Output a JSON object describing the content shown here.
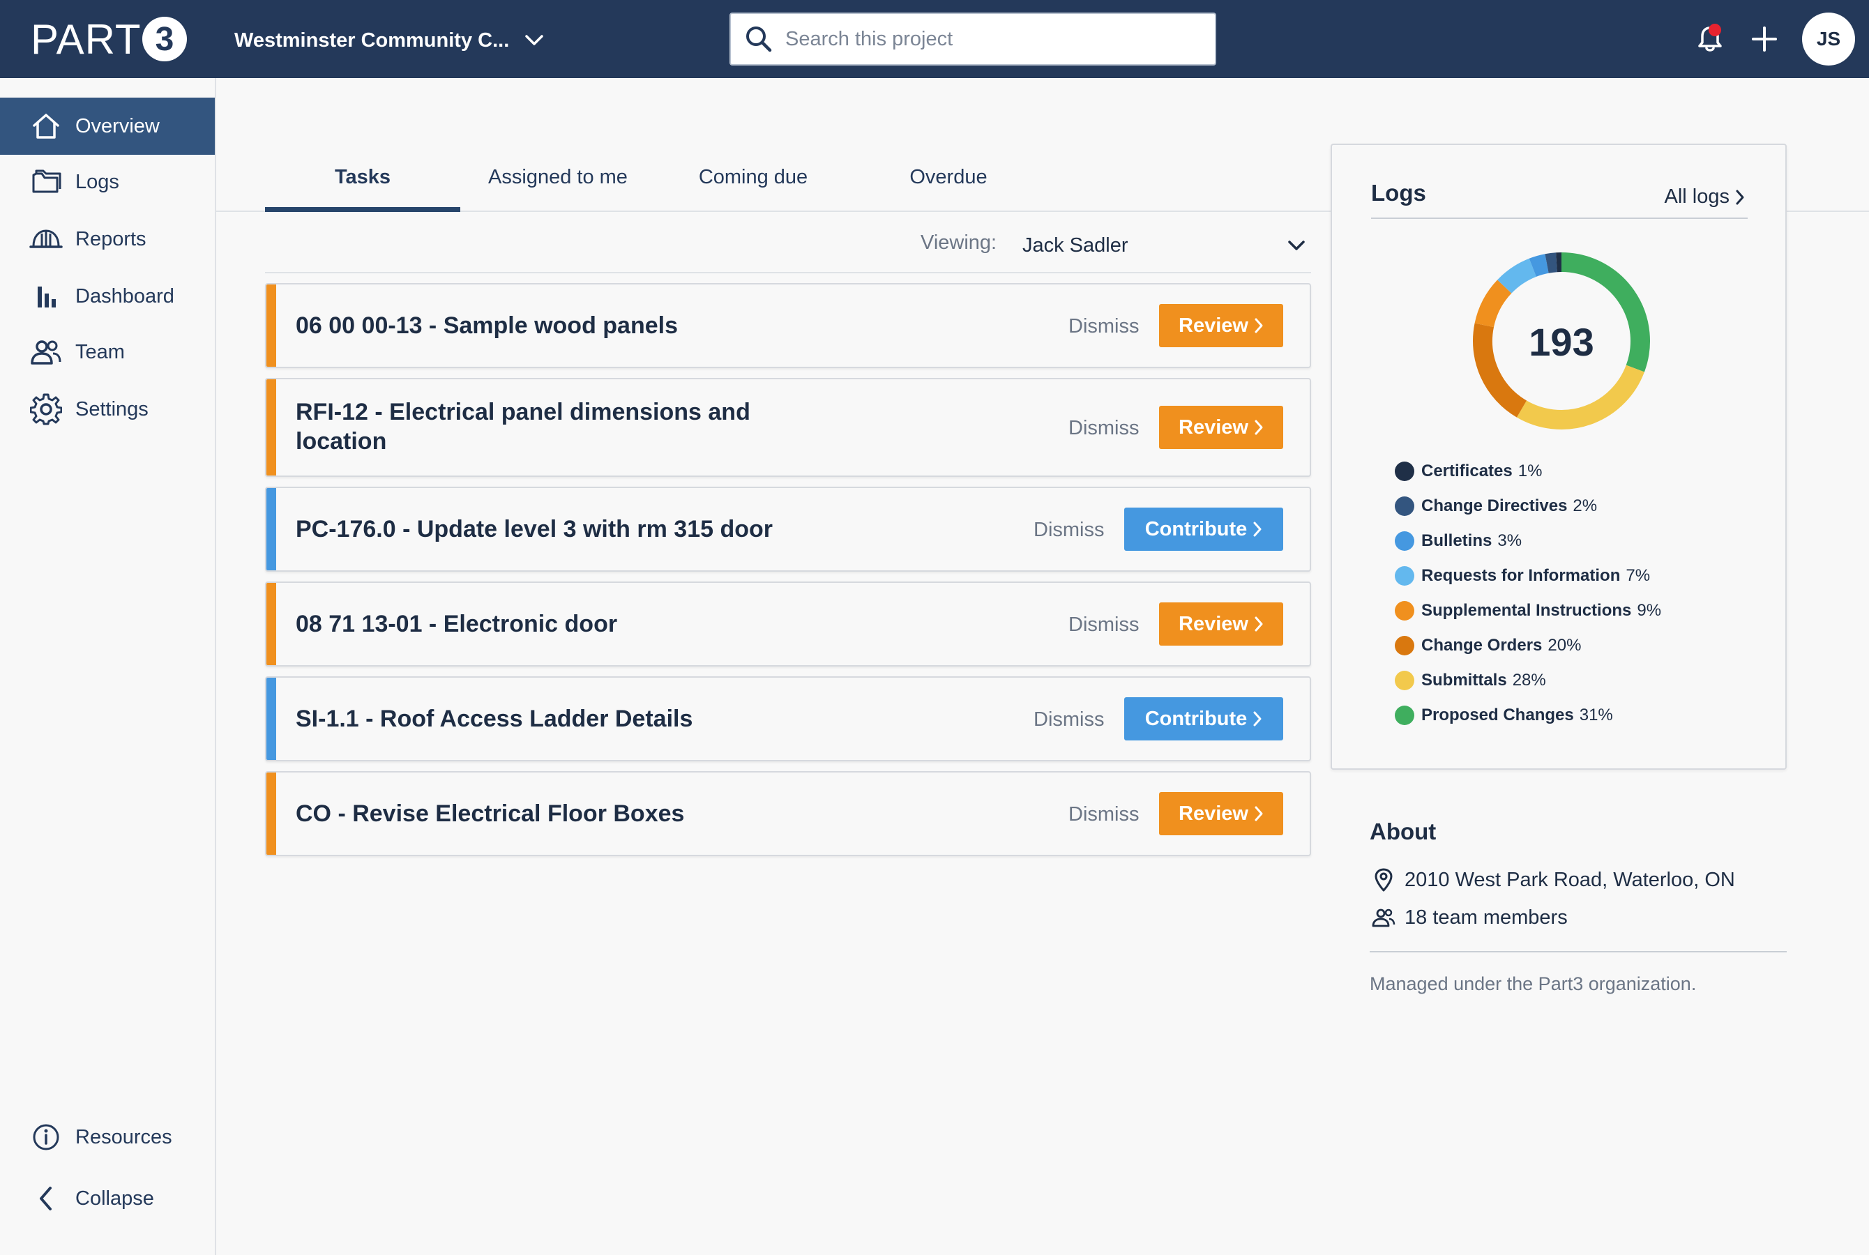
{
  "header": {
    "logo_text": "PART",
    "logo_mark": "3",
    "project_name": "Westminster Community C...",
    "search_placeholder": "Search this project",
    "avatar_initials": "JS"
  },
  "sidebar": {
    "items": [
      {
        "label": "Overview",
        "icon": "home-icon",
        "active": true
      },
      {
        "label": "Logs",
        "icon": "folder-icon"
      },
      {
        "label": "Reports",
        "icon": "hardhat-icon"
      },
      {
        "label": "Dashboard",
        "icon": "bar-chart-icon"
      },
      {
        "label": "Team",
        "icon": "people-icon"
      },
      {
        "label": "Settings",
        "icon": "gear-icon"
      }
    ],
    "bottom": [
      {
        "label": "Resources",
        "icon": "info-icon"
      },
      {
        "label": "Collapse",
        "icon": "chevron-left-icon"
      }
    ]
  },
  "tabs": [
    {
      "label": "Tasks",
      "active": true
    },
    {
      "label": "Assigned to me"
    },
    {
      "label": "Coming due"
    },
    {
      "label": "Overdue"
    }
  ],
  "viewing": {
    "label": "Viewing:",
    "value": "Jack Sadler"
  },
  "tasks": [
    {
      "title": "06 00 00-13 - Sample wood panels",
      "action": "Review",
      "dismiss": "Dismiss",
      "accent": "#f0901e"
    },
    {
      "title": "RFI-12 - Electrical panel dimensions and location",
      "action": "Review",
      "dismiss": "Dismiss",
      "accent": "#f0901e"
    },
    {
      "title": "PC-176.0 - Update level 3 with rm 315 door",
      "action": "Contribute",
      "dismiss": "Dismiss",
      "accent": "#4598e0"
    },
    {
      "title": "08 71 13-01 - Electronic door",
      "action": "Review",
      "dismiss": "Dismiss",
      "accent": "#f0901e"
    },
    {
      "title": "SI-1.1 - Roof Access Ladder Details",
      "action": "Contribute",
      "dismiss": "Dismiss",
      "accent": "#4598e0"
    },
    {
      "title": "CO - Revise Electrical Floor Boxes",
      "action": "Review",
      "dismiss": "Dismiss",
      "accent": "#f0901e"
    }
  ],
  "logs": {
    "title": "Logs",
    "all_link": "All logs",
    "total": "193",
    "legend": [
      {
        "label": "Certificates",
        "pct": "1%",
        "value": 1,
        "color": "#1f2f47"
      },
      {
        "label": "Change Directives",
        "pct": "2%",
        "value": 2,
        "color": "#33557f"
      },
      {
        "label": "Bulletins",
        "pct": "3%",
        "value": 3,
        "color": "#4598e0"
      },
      {
        "label": "Requests for Information",
        "pct": "7%",
        "value": 7,
        "color": "#63b8ee"
      },
      {
        "label": "Supplemental Instructions",
        "pct": "9%",
        "value": 9,
        "color": "#f0901e"
      },
      {
        "label": "Change Orders",
        "pct": "20%",
        "value": 20,
        "color": "#d9780f"
      },
      {
        "label": "Submittals",
        "pct": "28%",
        "value": 28,
        "color": "#f2c94c"
      },
      {
        "label": "Proposed Changes",
        "pct": "31%",
        "value": 31,
        "color": "#3fae5e"
      }
    ]
  },
  "about": {
    "title": "About",
    "address": "2010 West Park Road, Waterloo, ON",
    "team": "18 team members",
    "note": "Managed under the Part3 organization."
  }
}
